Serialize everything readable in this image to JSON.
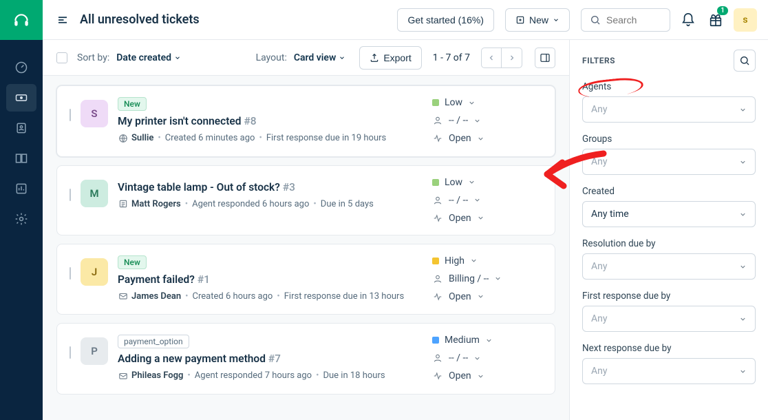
{
  "brand": {
    "logo_name": "headset"
  },
  "title": "All unresolved tickets",
  "topbar": {
    "get_started": "Get started (16%)",
    "new_label": "New",
    "search_placeholder": "Search",
    "gift_badge": "1",
    "avatar_initial": "s"
  },
  "toolbar": {
    "sort_label": "Sort by:",
    "sort_value": "Date created",
    "layout_label": "Layout:",
    "layout_value": "Card view",
    "export_label": "Export",
    "pager_text": "1 - 7 of 7"
  },
  "tickets": [
    {
      "avatar_initial": "S",
      "avatar_class": "av-lilac",
      "tags": [
        {
          "text": "New",
          "cls": "tag-new"
        }
      ],
      "title": "My printer isn't connected",
      "id": "#8",
      "source_icon": "globe",
      "requester": "Sullie",
      "meta": "Created 6 minutes ago",
      "meta2": "First response due in 19 hours",
      "priority": "Low",
      "pri_cls": "p-low",
      "group_text": "-- / --",
      "status": "Open",
      "highlight": true
    },
    {
      "avatar_initial": "M",
      "avatar_class": "av-green",
      "tags": [],
      "title": "Vintage table lamp - Out of stock?",
      "id": "#3",
      "source_icon": "form",
      "requester": "Matt Rogers",
      "meta": "Agent responded 6 hours ago",
      "meta2": "Due in 5 days",
      "priority": "Low",
      "pri_cls": "p-low",
      "group_text": "-- / --",
      "status": "Open"
    },
    {
      "avatar_initial": "J",
      "avatar_class": "av-yellow",
      "tags": [
        {
          "text": "New",
          "cls": "tag-new"
        }
      ],
      "title": "Payment failed?",
      "id": "#1",
      "source_icon": "mail",
      "requester": "James Dean",
      "meta": "Created 6 hours ago",
      "meta2": "First response due in 13 hours",
      "priority": "High",
      "pri_cls": "p-high",
      "group_text": "Billing / --",
      "status": "Open"
    },
    {
      "avatar_initial": "P",
      "avatar_class": "av-grey",
      "tags": [
        {
          "text": "payment_option",
          "cls": "tag-plain"
        }
      ],
      "title": "Adding a new payment method",
      "id": "#7",
      "source_icon": "mail",
      "requester": "Phileas Fogg",
      "meta": "Agent responded 7 hours ago",
      "meta2": "Due in 18 hours",
      "priority": "Medium",
      "pri_cls": "p-med",
      "group_text": "-- / --",
      "status": "Open"
    }
  ],
  "filters": {
    "heading": "FILTERS",
    "groups": [
      {
        "label": "Agents",
        "value": "Any",
        "placeholder": true,
        "scribble": true
      },
      {
        "label": "Groups",
        "value": "Any",
        "placeholder": true
      },
      {
        "label": "Created",
        "value": "Any time",
        "placeholder": false
      },
      {
        "label": "Resolution due by",
        "value": "Any",
        "placeholder": true
      },
      {
        "label": "First response due by",
        "value": "Any",
        "placeholder": true
      },
      {
        "label": "Next response due by",
        "value": "Any",
        "placeholder": true
      }
    ]
  }
}
